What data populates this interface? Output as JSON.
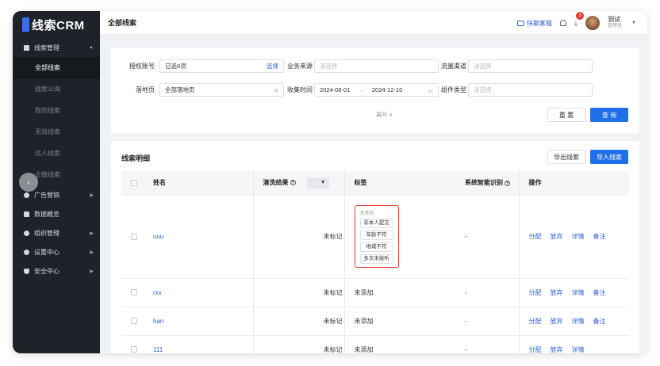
{
  "app": {
    "logo_text": "线索CRM"
  },
  "sidebar": {
    "group_main": "线索管理",
    "sub_items": [
      "全部线索",
      "线索公海",
      "我的线索",
      "无效线索",
      "达人线索",
      "企微线索"
    ],
    "other_groups": [
      "广告营销",
      "数据概览",
      "组织管理",
      "设置中心",
      "安全中心"
    ]
  },
  "header": {
    "title": "全部线索",
    "service_label": "快聊客服",
    "badge_count": "3",
    "user_name": "测试",
    "user_role": "管理员"
  },
  "filters": {
    "auth_label": "授权账号",
    "auth_value": "已选6项",
    "auth_action": "选择",
    "source_label": "业务来源",
    "source_placeholder": "请选择",
    "channel_label": "流量渠道",
    "channel_placeholder": "请选择",
    "landing_label": "落地页",
    "landing_value": "全部落地页",
    "time_label": "收集时间",
    "date_start": "2024-08-01",
    "date_sep": "→",
    "date_end": "2024-12-10",
    "widget_label": "组件类型",
    "widget_placeholder": "请选择",
    "reset_label": "重 置",
    "query_label": "查 询",
    "expand_label": "展开 ∨"
  },
  "detail": {
    "title": "线索明细",
    "export_label": "导出线索",
    "import_label": "导入线索",
    "columns": [
      "姓名",
      "清洗结果",
      "标签",
      "系统智能识别",
      "操作"
    ],
    "ops": [
      "分配",
      "放弃",
      "详情",
      "备注"
    ],
    "tag_popup": {
      "title": "无意向",
      "chips": [
        "非本人提交",
        "年龄不符",
        "地域不符",
        "多次未接听"
      ]
    },
    "rows": [
      {
        "name": "uuu",
        "clean": "未标记",
        "tag": "",
        "ai": "-"
      },
      {
        "name": "rxx",
        "clean": "未标记",
        "tag": "未添加",
        "ai": "-"
      },
      {
        "name": "han",
        "clean": "未标记",
        "tag": "未添加",
        "ai": "-"
      },
      {
        "name": "111",
        "clean": "未标记",
        "tag": "未添加",
        "ai": "-"
      }
    ]
  }
}
